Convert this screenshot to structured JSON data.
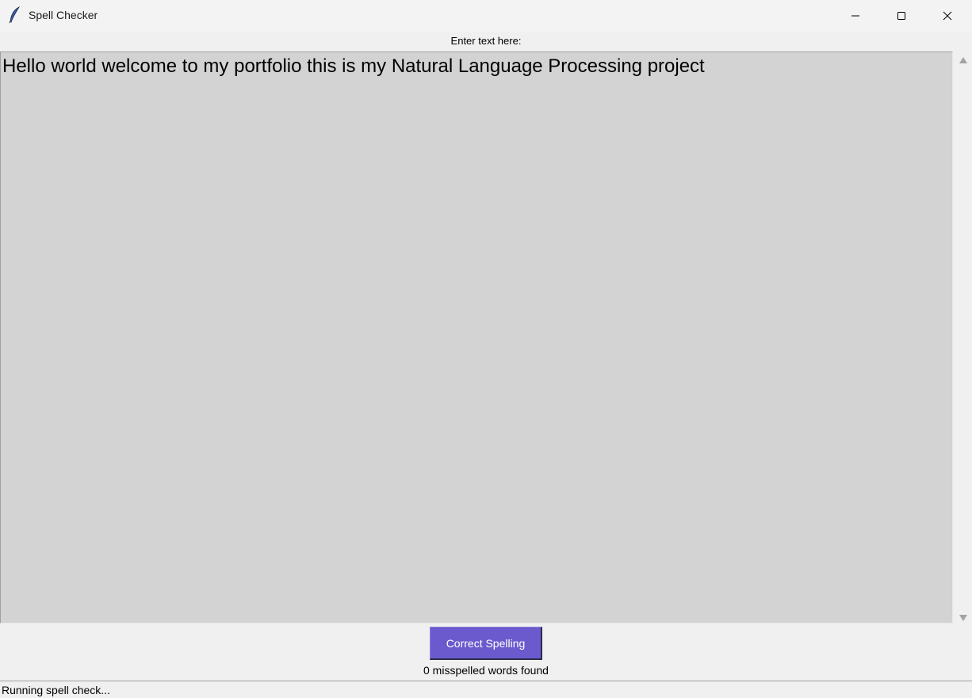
{
  "window": {
    "title": "Spell Checker",
    "controls": [
      "minimize-icon",
      "maximize-icon",
      "close-icon"
    ],
    "app_icon": "feather-icon"
  },
  "main": {
    "prompt_label": "Enter text here:",
    "text_value": "Hello world welcome to my portfolio this is my Natural Language Processing project",
    "text_area_bg": "#d3d3d3"
  },
  "actions": {
    "correct_label": "Correct Spelling",
    "button_color": "#6a5acd"
  },
  "result": {
    "message": "0 misspelled words found"
  },
  "status": {
    "text": "Running spell check..."
  }
}
